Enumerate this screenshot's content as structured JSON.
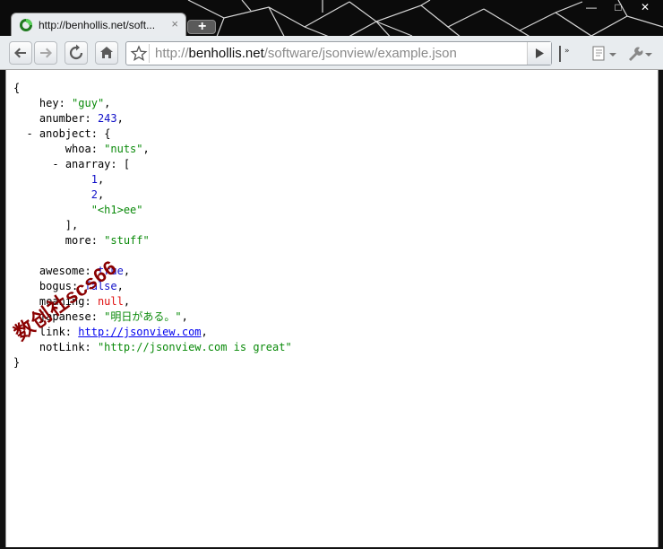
{
  "tab": {
    "title": "http://benhollis.net/soft...",
    "close": "×"
  },
  "window": {
    "minimize": "—",
    "maximize": "□",
    "close": "✕"
  },
  "address": {
    "host": "benhollis.net",
    "scheme": "http://",
    "path": "/software/jsonview/example.json"
  },
  "json": {
    "open_brace": "{",
    "hey_key": "hey:",
    "hey_val": "\"guy\"",
    "comma": ",",
    "anumber_key": "anumber:",
    "anumber_val": "243",
    "anobject_toggle": "-",
    "anobject_key": "anobject:",
    "anobject_open": "{",
    "whoa_key": "whoa:",
    "whoa_val": "\"nuts\"",
    "anarray_toggle": "-",
    "anarray_key": "anarray:",
    "anarray_open": "[",
    "arr1": "1",
    "arr2": "2",
    "arr3": "\"<h1>ee\"",
    "anarray_close": "],",
    "more_key": "more:",
    "more_val": "\"stuff\"",
    "awesome_key": "awesome:",
    "awesome_val": "true",
    "bogus_key": "bogus:",
    "bogus_val": "false",
    "meaning_key": "meaning:",
    "meaning_val": "null",
    "japanese_key": "japanese:",
    "japanese_val": "\"明日がある。\"",
    "link_key": "link:",
    "link_val": "http://jsonview.com",
    "notlink_key": "notLink:",
    "notlink_val": "\"http://jsonview.com is great\"",
    "close_brace": "}"
  },
  "watermark": "数创社scs66"
}
